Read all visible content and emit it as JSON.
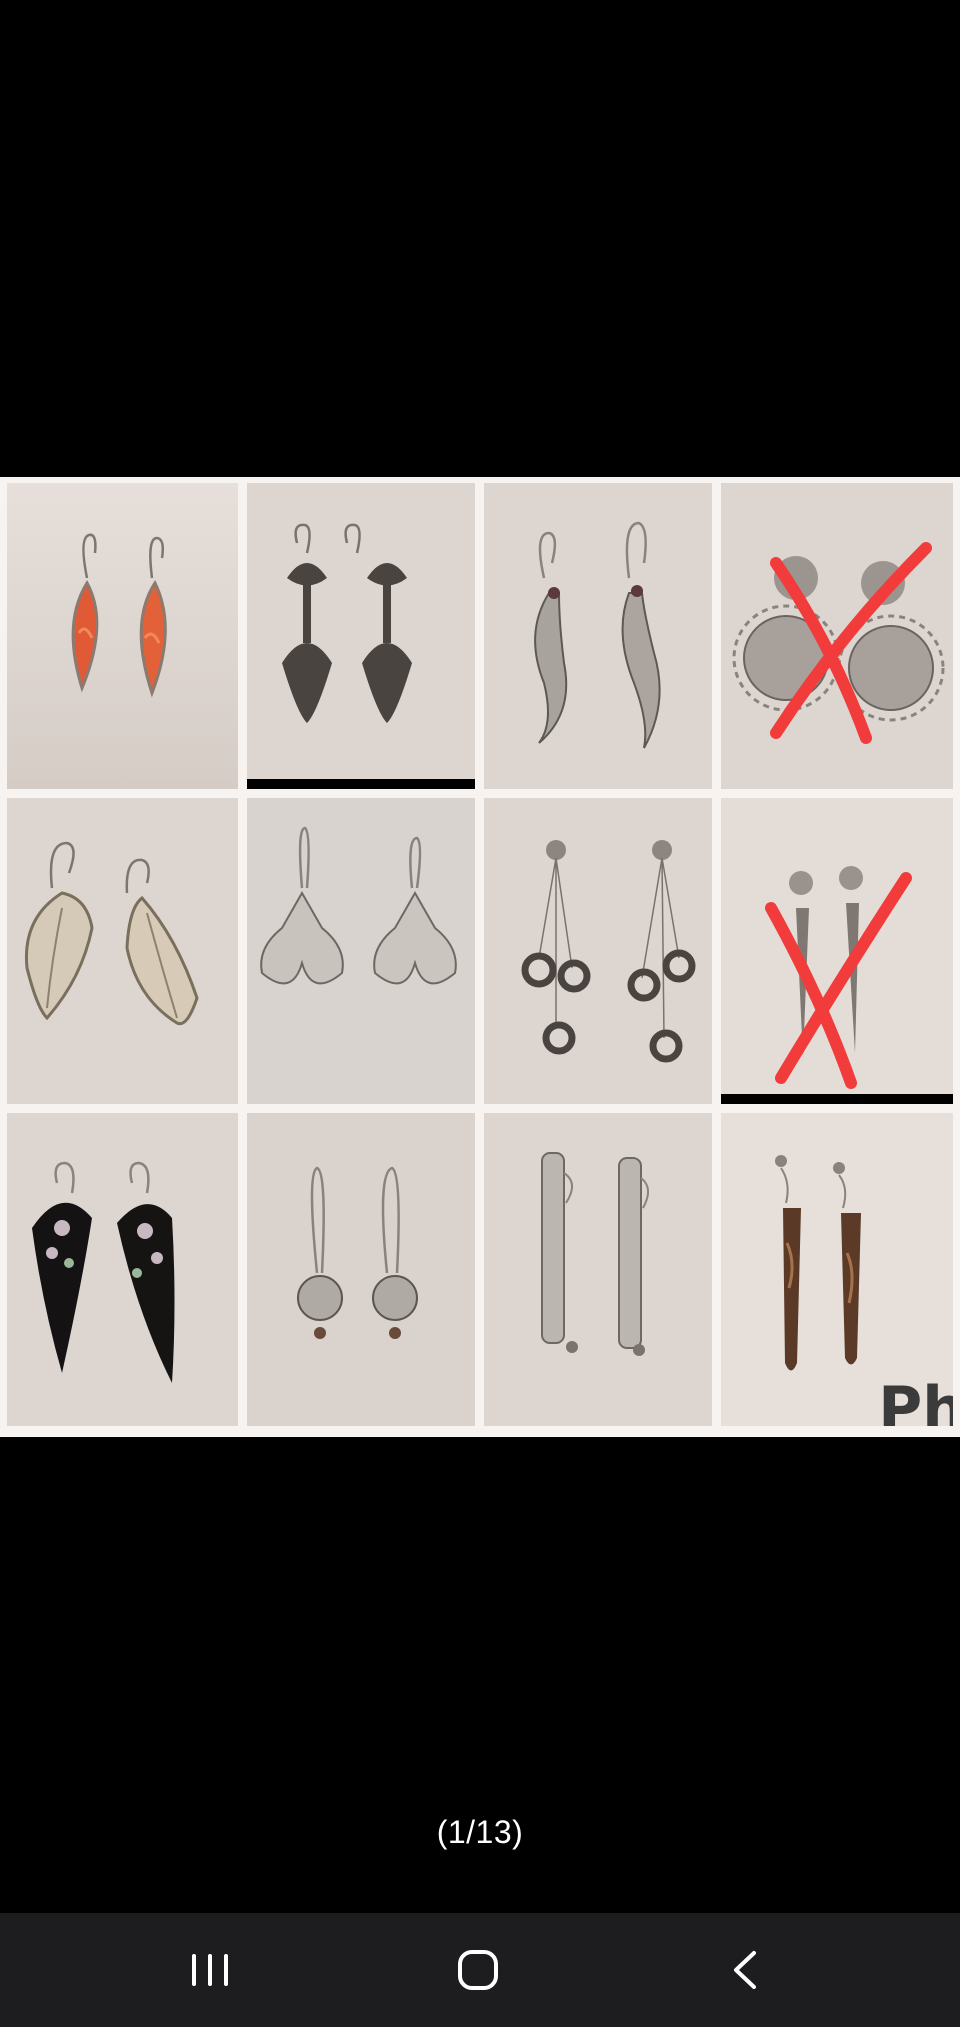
{
  "viewer": {
    "counter": "(1/13)",
    "watermark": "Ph"
  },
  "gallery": {
    "tiles": [
      {
        "icon": "coral-marquise-earring-icon",
        "crossed_out": false
      },
      {
        "icon": "filigree-drop-earring-icon",
        "crossed_out": false
      },
      {
        "icon": "silver-swirl-earring-icon",
        "crossed_out": false
      },
      {
        "icon": "sun-earring-icon",
        "crossed_out": true
      },
      {
        "icon": "silver-leaf-earring-icon",
        "crossed_out": false
      },
      {
        "icon": "arrow-crescent-earring-icon",
        "crossed_out": false
      },
      {
        "icon": "chain-ring-drop-earring-icon",
        "crossed_out": false
      },
      {
        "icon": "silver-spike-earring-icon",
        "crossed_out": true
      },
      {
        "icon": "abalone-inlay-teardrop-earring-icon",
        "crossed_out": false
      },
      {
        "icon": "silver-bead-earring-icon",
        "crossed_out": false
      },
      {
        "icon": "glitter-hoop-earring-icon",
        "crossed_out": false
      },
      {
        "icon": "stone-bar-earring-icon",
        "crossed_out": false
      }
    ]
  },
  "colors": {
    "background": "#000000",
    "tile_background": "#ddd5d0",
    "cross_mark": "#f23b3b",
    "navbar": "#1d1d20"
  },
  "navbar": {
    "recent_icon": "recent-apps-icon",
    "home_icon": "home-icon",
    "back_icon": "back-icon"
  }
}
